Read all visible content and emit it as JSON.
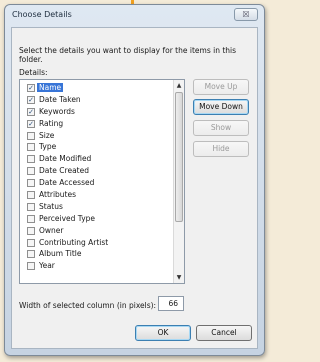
{
  "window": {
    "title": "Choose Details",
    "close_label": "☒"
  },
  "instruction": "Select the details you want to display for the items in this folder.",
  "details_label": "Details:",
  "list": {
    "items": [
      {
        "label": "Name",
        "checked": true,
        "selected": true
      },
      {
        "label": "Date Taken",
        "checked": true
      },
      {
        "label": "Keywords",
        "checked": true
      },
      {
        "label": "Rating",
        "checked": true
      },
      {
        "label": "Size",
        "checked": false
      },
      {
        "label": "Type",
        "checked": false
      },
      {
        "label": "Date Modified",
        "checked": false
      },
      {
        "label": "Date Created",
        "checked": false
      },
      {
        "label": "Date Accessed",
        "checked": false
      },
      {
        "label": "Attributes",
        "checked": false
      },
      {
        "label": "Status",
        "checked": false
      },
      {
        "label": "Perceived Type",
        "checked": false
      },
      {
        "label": "Owner",
        "checked": false
      },
      {
        "label": "Contributing Artist",
        "checked": false
      },
      {
        "label": "Album Title",
        "checked": false
      },
      {
        "label": "Year",
        "checked": false
      }
    ]
  },
  "buttons": {
    "move_up": "Move Up",
    "move_down": "Move Down",
    "show": "Show",
    "hide": "Hide",
    "ok": "OK",
    "cancel": "Cancel"
  },
  "width": {
    "label": "Width of selected column (in pixels):",
    "value": "66"
  },
  "icons": {
    "check": "✓",
    "scroll_up": "▲",
    "scroll_down": "▼"
  },
  "colors": {
    "selection": "#3875d7",
    "window_frame": "#c6d3e2",
    "background": "#f4ebd8"
  }
}
